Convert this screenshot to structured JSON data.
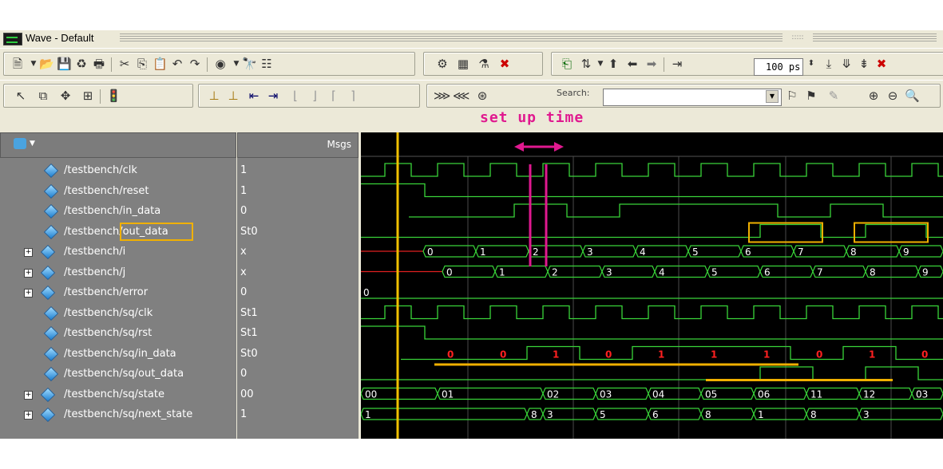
{
  "window": {
    "title": "Wave - Default"
  },
  "toolbar": {
    "time_step": "100 ps",
    "search_label": "Search:",
    "search_value": ""
  },
  "annotation": {
    "setup_time": "set up time"
  },
  "panes": {
    "values_header": "Msgs"
  },
  "signals": [
    {
      "name": "/testbench/clk",
      "value": "1",
      "expandable": false
    },
    {
      "name": "/testbench/reset",
      "value": "1",
      "expandable": false
    },
    {
      "name": "/testbench/in_data",
      "value": "0",
      "expandable": false
    },
    {
      "name": "/testbench/out_data",
      "value": "St0",
      "expandable": false
    },
    {
      "name": "/testbench/i",
      "value": "x",
      "expandable": true
    },
    {
      "name": "/testbench/j",
      "value": "x",
      "expandable": true
    },
    {
      "name": "/testbench/error",
      "value": "0",
      "expandable": true
    },
    {
      "name": "/testbench/sq/clk",
      "value": "St1",
      "expandable": false
    },
    {
      "name": "/testbench/sq/rst",
      "value": "St1",
      "expandable": false
    },
    {
      "name": "/testbench/sq/in_data",
      "value": "St0",
      "expandable": false
    },
    {
      "name": "/testbench/sq/out_data",
      "value": "0",
      "expandable": false
    },
    {
      "name": "/testbench/sq/state",
      "value": "00",
      "expandable": true
    },
    {
      "name": "/testbench/sq/next_state",
      "value": "1",
      "expandable": true
    }
  ],
  "bus_values": {
    "i": [
      "0",
      "1",
      "2",
      "3",
      "4",
      "5",
      "6",
      "7",
      "8",
      "9"
    ],
    "j": [
      "0",
      "1",
      "2",
      "3",
      "4",
      "5",
      "6",
      "7",
      "8",
      "9"
    ],
    "error": [
      "0"
    ],
    "state": [
      "00",
      "01",
      "02",
      "03",
      "04",
      "05",
      "06",
      "11",
      "12",
      "03"
    ],
    "next_state": [
      "1",
      "8",
      "3",
      "5",
      "6",
      "8",
      "1",
      "8",
      "3"
    ]
  },
  "in_data_labels": [
    "0",
    "0",
    "1",
    "0",
    "1",
    "1",
    "1",
    "0",
    "1",
    "0"
  ],
  "colors": {
    "wave_green": "#39d439",
    "cursor_yellow": "#f0c000",
    "annotation_pink": "#e0198f",
    "highlight_orange": "#f0b000",
    "bit_red": "#ff2020",
    "undefined_red": "#e02020"
  }
}
